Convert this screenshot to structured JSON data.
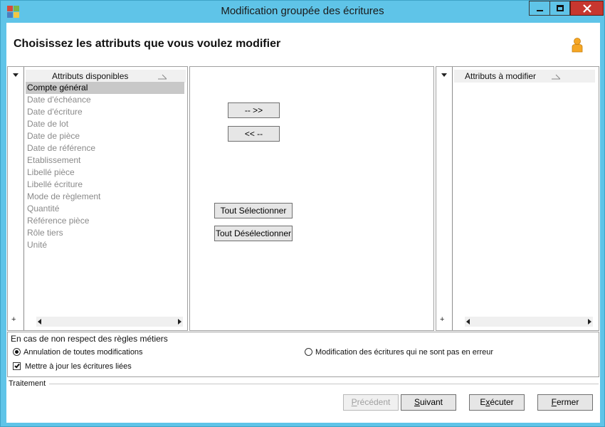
{
  "window": {
    "title": "Modification groupée des écritures"
  },
  "header": {
    "title": "Choisissez les attributs que vous voulez modifier"
  },
  "available_list": {
    "header": "Attributs disponibles",
    "items": [
      "Compte général",
      "Date d'échéance",
      "Date d'écriture",
      "Date de lot",
      "Date de pièce",
      "Date de référence",
      "Etablissement",
      "Libellé pièce",
      "Libellé écriture",
      "Mode de règlement",
      "Quantité",
      "Référence pièce",
      "Rôle tiers",
      "Unité"
    ],
    "selected_index": 0,
    "plus": "+"
  },
  "modify_list": {
    "header": "Attributs à modifier",
    "items": [],
    "plus": "+"
  },
  "transfer": {
    "add_label": "-- >>",
    "remove_label": "<< --",
    "select_all_label": "Tout Sélectionner",
    "deselect_all_label": "Tout Désélectionner"
  },
  "rules": {
    "title": "En cas de non respect des règles métiers",
    "option_cancel_all": "Annulation de toutes modifications",
    "option_modify_valid": "Modification des écritures qui ne sont pas en erreur",
    "selected_option": "cancel_all",
    "update_linked_label": "Mettre à jour les écritures liées",
    "update_linked_checked": true
  },
  "treatment": {
    "label": "Traitement"
  },
  "actions": {
    "previous": {
      "label": "Précédent",
      "mnemonic": "P",
      "rest": "récédent",
      "enabled": false
    },
    "next": {
      "label": "Suivant",
      "mnemonic": "S",
      "rest": "uivant",
      "enabled": true
    },
    "execute": {
      "label": "Exécuter",
      "mnemonic": "x",
      "pre": "E",
      "rest": "écuter",
      "enabled": true
    },
    "close": {
      "label": "Fermer",
      "mnemonic": "F",
      "rest": "ermer",
      "enabled": true
    }
  },
  "colors": {
    "titlebar": "#5fc4e8",
    "close_button": "#c7372f",
    "selected_item": "#c8c8c8",
    "disabled_item_text": "#8a8a8a",
    "user_icon": "#f5a623"
  },
  "icons": {
    "app": "app-icon",
    "user": "user-icon",
    "minimize": "minimize-icon",
    "maximize": "maximize-icon",
    "close": "close-icon"
  }
}
